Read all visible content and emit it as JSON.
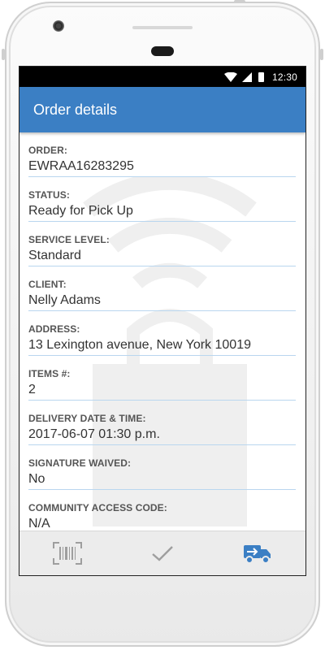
{
  "status_bar": {
    "time": "12:30"
  },
  "app_bar": {
    "title": "Order details"
  },
  "fields": [
    {
      "label": "ORDER:",
      "value": "EWRAA16283295"
    },
    {
      "label": "STATUS:",
      "value": "Ready for Pick Up"
    },
    {
      "label": "SERVICE LEVEL:",
      "value": "Standard"
    },
    {
      "label": "CLIENT:",
      "value": "Nelly Adams"
    },
    {
      "label": "ADDRESS:",
      "value": "13 Lexington avenue, New York 10019"
    },
    {
      "label": "ITEMS #:",
      "value": "2"
    },
    {
      "label": "DELIVERY DATE & TIME:",
      "value": "2017-06-07 01:30 p.m."
    },
    {
      "label": "SIGNATURE WAIVED:",
      "value": "No"
    },
    {
      "label": "COMMUNITY ACCESS CODE:",
      "value": "N/A"
    }
  ],
  "bottom_bar": {
    "icons": [
      "barcode-icon",
      "checkmark-icon",
      "delivery-truck-icon"
    ],
    "accent_color": "#3b7fc4",
    "inactive_color": "#9e9e9e"
  },
  "colors": {
    "app_bar": "#3b7fc4",
    "divider": "#b9d6ef"
  }
}
